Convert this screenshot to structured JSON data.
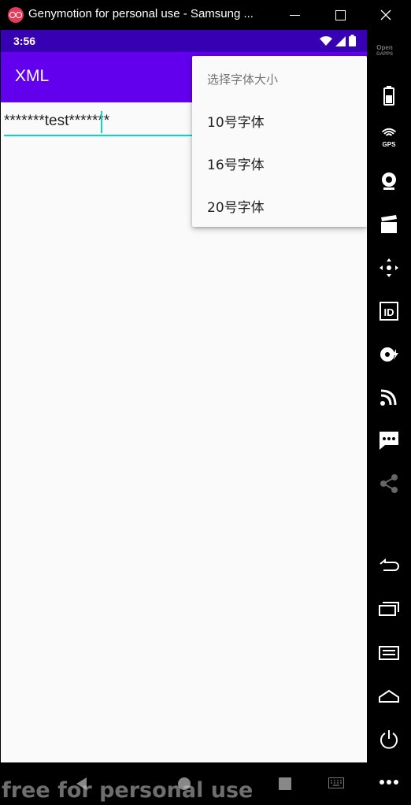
{
  "window": {
    "title": "Genymotion for personal use - Samsung ..."
  },
  "status_bar": {
    "time": "3:56"
  },
  "app_bar": {
    "title": "XML"
  },
  "edit_text": {
    "value": "*******test*******"
  },
  "popup_menu": {
    "header": "选择字体大小",
    "items": [
      {
        "label": "10号字体"
      },
      {
        "label": "16号字体"
      },
      {
        "label": "20号字体"
      }
    ]
  },
  "sidebar": {
    "open_gapps_label_1": "Open",
    "open_gapps_label_2": "GAPPS",
    "gps_label": "GPS",
    "id_label": "ID"
  },
  "watermark": "free for personal use",
  "colors": {
    "status_bar": "#3700b3",
    "app_bar": "#6200ee",
    "accent": "#03dac5"
  },
  "icons": [
    "genymotion-logo-icon",
    "minimize-icon",
    "maximize-icon",
    "close-icon",
    "wifi-icon",
    "signal-icon",
    "battery-icon",
    "gps-icon",
    "webcam-icon",
    "media-icon",
    "dpad-icon",
    "device-id-icon",
    "disk-io-icon",
    "network-icon",
    "sms-icon",
    "share-icon",
    "back-icon",
    "recent-apps-icon",
    "menu-icon",
    "home-icon",
    "power-icon",
    "more-icon"
  ]
}
